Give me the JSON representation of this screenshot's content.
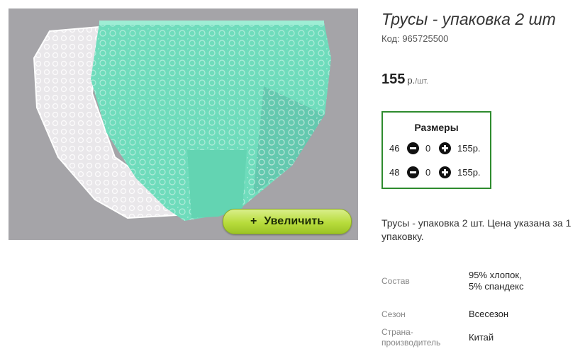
{
  "product": {
    "title": "Трусы - упаковка 2 шт",
    "code": "Код: 965725500",
    "price_value": "155",
    "price_currency": "р.",
    "price_unit": "/шт.",
    "zoom_button": "Увеличить",
    "zoom_icon": "plus-icon",
    "description": "Трусы - упаковка 2 шт. Цена указана за 1 упаковку."
  },
  "sizes": {
    "title": "Размеры",
    "rows": [
      {
        "size": "46",
        "qty": "0",
        "price": "155р."
      },
      {
        "size": "48",
        "qty": "0",
        "price": "155р."
      }
    ]
  },
  "properties": [
    {
      "label": "Состав",
      "value": "95% хлопок, 5% спандекс"
    },
    {
      "label": "Сезон",
      "value": "Всесезон"
    },
    {
      "label": "Страна-производитель",
      "value": "Китай"
    }
  ],
  "colors": {
    "accent_border": "#2e8b2e",
    "zoom_button": "#b8dc3c",
    "photo_background": "#a5a4a8",
    "product_mint": "#6fdcbc"
  }
}
